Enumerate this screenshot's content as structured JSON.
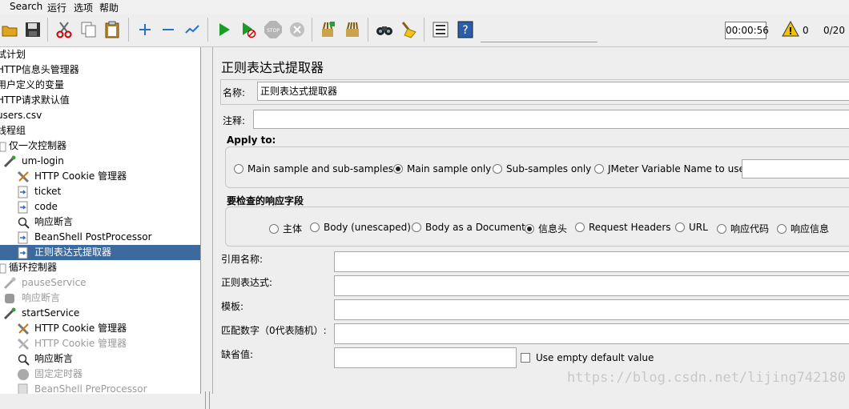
{
  "menu": {
    "items": [
      "Search",
      "运行",
      "选项",
      "帮助"
    ]
  },
  "toolbar": {
    "icons": [
      "open-icon",
      "save-icon",
      "cut-icon",
      "copy-icon",
      "paste-icon",
      "expand-icon",
      "collapse-icon",
      "toggle-icon",
      "start-icon",
      "start-no-pause-icon",
      "stop-icon",
      "shutdown-icon",
      "clear-icon",
      "clear-all-icon",
      "search-icon",
      "reset-search-icon",
      "function-helper-icon",
      "help-icon"
    ],
    "timer": "00:00:56",
    "warnings": "0",
    "threads": "0/20"
  },
  "tree": {
    "items": [
      {
        "label": "试计划"
      },
      {
        "label": "HTTP信息头管理器"
      },
      {
        "label": "用户定义的变量"
      },
      {
        "label": "HTTP请求默认值"
      },
      {
        "label": "users.csv"
      },
      {
        "label": "线程组"
      },
      {
        "label": "仅一次控制器"
      },
      {
        "label": "um-login"
      },
      {
        "label": "HTTP Cookie 管理器"
      },
      {
        "label": "ticket"
      },
      {
        "label": "code"
      },
      {
        "label": "响应断言"
      },
      {
        "label": "BeanShell PostProcessor"
      },
      {
        "label": "正则表达式提取器"
      },
      {
        "label": "循环控制器"
      },
      {
        "label": "pauseService"
      },
      {
        "label": "响应断言"
      },
      {
        "label": "startService"
      },
      {
        "label": "HTTP Cookie 管理器"
      },
      {
        "label": "HTTP Cookie 管理器"
      },
      {
        "label": "响应断言"
      },
      {
        "label": "固定定时器"
      },
      {
        "label": "BeanShell PreProcessor"
      }
    ]
  },
  "panel": {
    "title": "正则表达式提取器",
    "name_label": "名称:",
    "name_value": "正则表达式提取器",
    "comment_label": "注释:",
    "comment_value": "",
    "apply_to": {
      "title": "Apply to:",
      "options": [
        "Main sample and sub-samples",
        "Main sample only",
        "Sub-samples only",
        "JMeter Variable Name to use"
      ],
      "selected": "Main sample only",
      "variable_value": ""
    },
    "field_to_check": {
      "title": "要检查的响应字段",
      "options": [
        "主体",
        "Body (unescaped)",
        "Body as a Document",
        "信息头",
        "Request Headers",
        "URL",
        "响应代码",
        "响应信息"
      ],
      "selected": "信息头"
    },
    "ref_name_label": "引用名称:",
    "ref_name_value": "",
    "regex_label": "正则表达式:",
    "regex_value": "",
    "template_label": "模板:",
    "template_value": "",
    "match_no_label": "匹配数字（0代表随机）:",
    "match_no_value": "",
    "default_label": "缺省值:",
    "default_value": "",
    "use_empty_label": "Use empty default value",
    "use_empty_checked": false
  },
  "watermark": "https://blog.csdn.net/lijing742180"
}
